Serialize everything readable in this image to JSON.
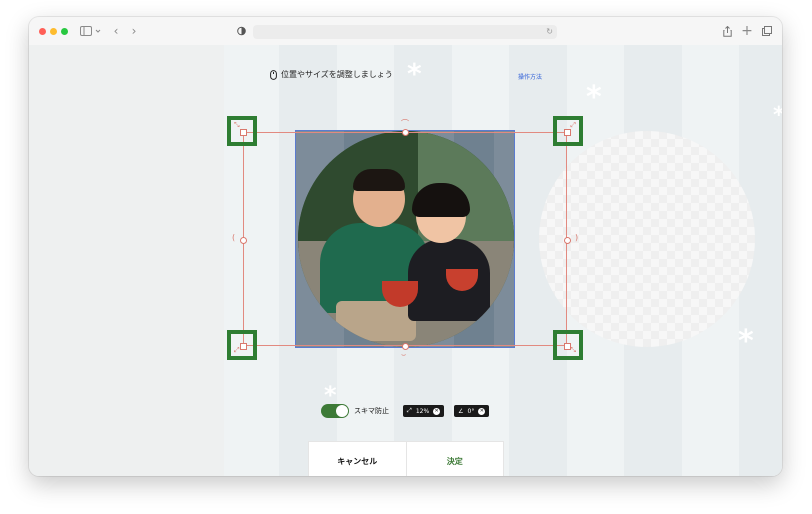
{
  "browser": {
    "sidebar_icon": "sidebar-toggle-icon",
    "url": "",
    "colors": {
      "close": "#ff5f57",
      "minimize": "#febc2e",
      "zoom": "#28c840"
    }
  },
  "editor": {
    "hint_icon": "mouse-icon",
    "hint_text": "位置やサイズを調整しましょう",
    "howto_link": "操作方法",
    "gap_toggle": {
      "label": "スキマ防止",
      "on": true
    },
    "scale": {
      "icon": "resize-icon",
      "value": "12%"
    },
    "rotation": {
      "icon": "angle-icon",
      "value": "0°"
    },
    "cancel_label": "キャンセル",
    "confirm_label": "決定",
    "accent_color": "#3d7a37",
    "handle_color": "#2e7d32"
  }
}
